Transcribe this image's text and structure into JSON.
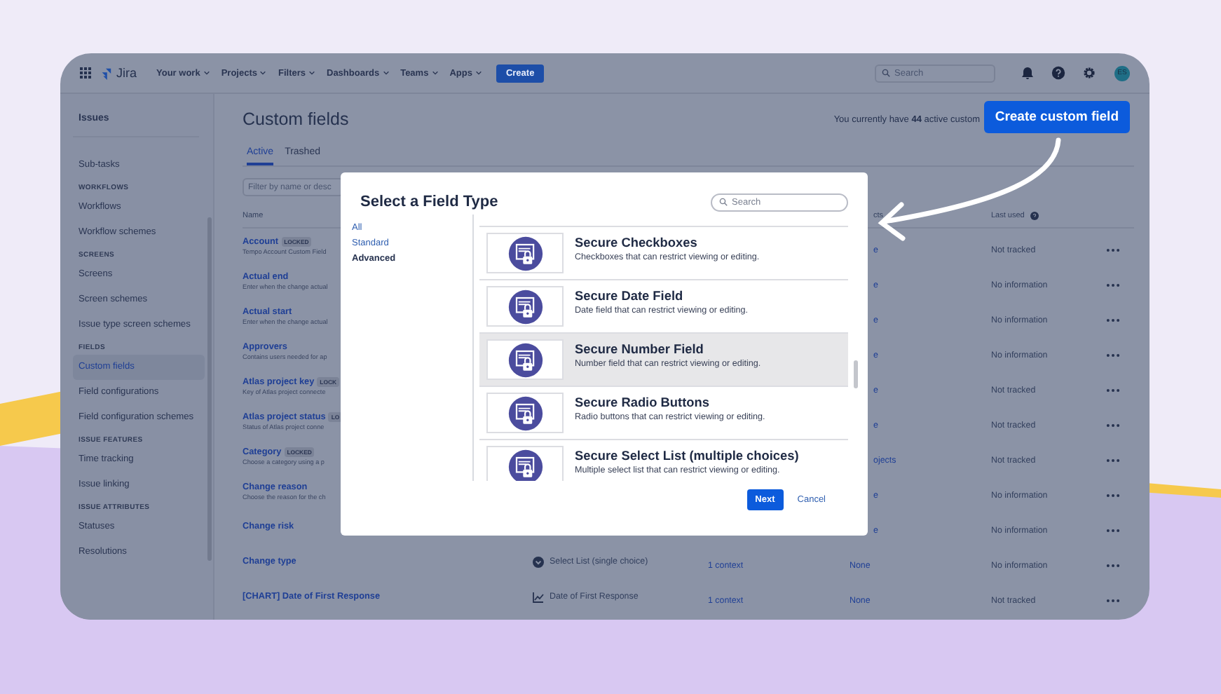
{
  "nav": {
    "logo": "Jira",
    "menus": [
      {
        "label": "Your work"
      },
      {
        "label": "Projects"
      },
      {
        "label": "Filters"
      },
      {
        "label": "Dashboards"
      },
      {
        "label": "Teams"
      },
      {
        "label": "Apps"
      }
    ],
    "create": "Create",
    "search_placeholder": "Search",
    "avatar": "ES"
  },
  "sidebar": {
    "items": [
      {
        "kind": "top",
        "label": "Issues"
      },
      {
        "kind": "link",
        "label": "Sub-tasks",
        "selected": false
      },
      {
        "kind": "heading",
        "label": "WORKFLOWS"
      },
      {
        "kind": "link",
        "label": "Workflows",
        "selected": false
      },
      {
        "kind": "link",
        "label": "Workflow schemes",
        "selected": false
      },
      {
        "kind": "heading",
        "label": "SCREENS"
      },
      {
        "kind": "link",
        "label": "Screens",
        "selected": false
      },
      {
        "kind": "link",
        "label": "Screen schemes",
        "selected": false
      },
      {
        "kind": "link",
        "label": "Issue type screen schemes",
        "selected": false
      },
      {
        "kind": "heading",
        "label": "FIELDS"
      },
      {
        "kind": "link",
        "label": "Custom fields",
        "selected": true
      },
      {
        "kind": "link",
        "label": "Field configurations",
        "selected": false
      },
      {
        "kind": "link",
        "label": "Field configuration schemes",
        "selected": false
      },
      {
        "kind": "heading",
        "label": "ISSUE FEATURES"
      },
      {
        "kind": "link",
        "label": "Time tracking",
        "selected": false
      },
      {
        "kind": "link",
        "label": "Issue linking",
        "selected": false
      },
      {
        "kind": "heading",
        "label": "ISSUE ATTRIBUTES"
      },
      {
        "kind": "link",
        "label": "Statuses",
        "selected": false
      },
      {
        "kind": "link",
        "label": "Resolutions",
        "selected": false
      }
    ]
  },
  "page": {
    "title": "Custom fields",
    "summary": "You currently have **44** active custom",
    "create_button": "Create custom field",
    "tabs": [
      {
        "label": "Active",
        "selected": true
      },
      {
        "label": "Trashed",
        "selected": false
      }
    ],
    "filter_placeholder": "Filter by name or desc"
  },
  "table": {
    "header": {
      "name": "Name",
      "column_4": "cts",
      "last_used": "Last used"
    },
    "rows": [
      {
        "name": "Account",
        "badge": "LOCKED",
        "description": "Tempo Account Custom Field",
        "column_4": "e",
        "last_used": "Not tracked"
      },
      {
        "name": "Actual end",
        "description": "Enter when the change actual",
        "column_4": "e",
        "last_used": "No information"
      },
      {
        "name": "Actual start",
        "description": "Enter when the change actual",
        "column_4": "e",
        "last_used": "No information"
      },
      {
        "name": "Approvers",
        "description": "Contains users needed for ap",
        "column_4": "e",
        "last_used": "No information"
      },
      {
        "name": "Atlas project key",
        "badge": "LOCK",
        "description": "Key of Atlas project connecte",
        "column_4": "e",
        "last_used": "Not tracked"
      },
      {
        "name": "Atlas project status",
        "badge": "LO",
        "description": "Status of Atlas project conne",
        "column_4": "e",
        "last_used": "Not tracked"
      },
      {
        "name": "Category",
        "badge": "LOCKED",
        "description": "Choose a category using a p",
        "column_4": "ojects",
        "last_used": "Not tracked"
      },
      {
        "name": "Change reason",
        "description": "Choose the reason for the ch",
        "column_4": "e",
        "last_used": "No information"
      },
      {
        "name": "Change risk",
        "column_4": "e",
        "last_used": "No information"
      },
      {
        "name": "Change type",
        "type": {
          "kind": "select",
          "label": "Select List (single choice)"
        },
        "context": "1 context",
        "projects": "None",
        "last_used": "No information"
      },
      {
        "name": "[CHART] Date of First Response",
        "type": {
          "kind": "chart",
          "label": "Date of First Response"
        },
        "context": "1 context",
        "projects": "None",
        "last_used": "Not tracked"
      }
    ]
  },
  "modal": {
    "title": "Select a Field Type",
    "search_placeholder": "Search",
    "categories": [
      {
        "label": "All",
        "selected": false
      },
      {
        "label": "Standard",
        "selected": false
      },
      {
        "label": "Advanced",
        "selected": true
      }
    ],
    "field_types": [
      {
        "name": "Secure Checkboxes",
        "description": "Checkboxes that can restrict viewing or editing.",
        "selected": false
      },
      {
        "name": "Secure Date Field",
        "description": "Date field that can restrict viewing or editing.",
        "selected": false
      },
      {
        "name": "Secure Number Field",
        "description": "Number field that can restrict viewing or editing.",
        "selected": true
      },
      {
        "name": "Secure Radio Buttons",
        "description": "Radio buttons that can restrict viewing or editing.",
        "selected": false
      },
      {
        "name": "Secure Select List (multiple choices)",
        "description": "Multiple select list that can restrict viewing or editing.",
        "selected": false
      }
    ],
    "next": "Next",
    "cancel": "Cancel"
  }
}
